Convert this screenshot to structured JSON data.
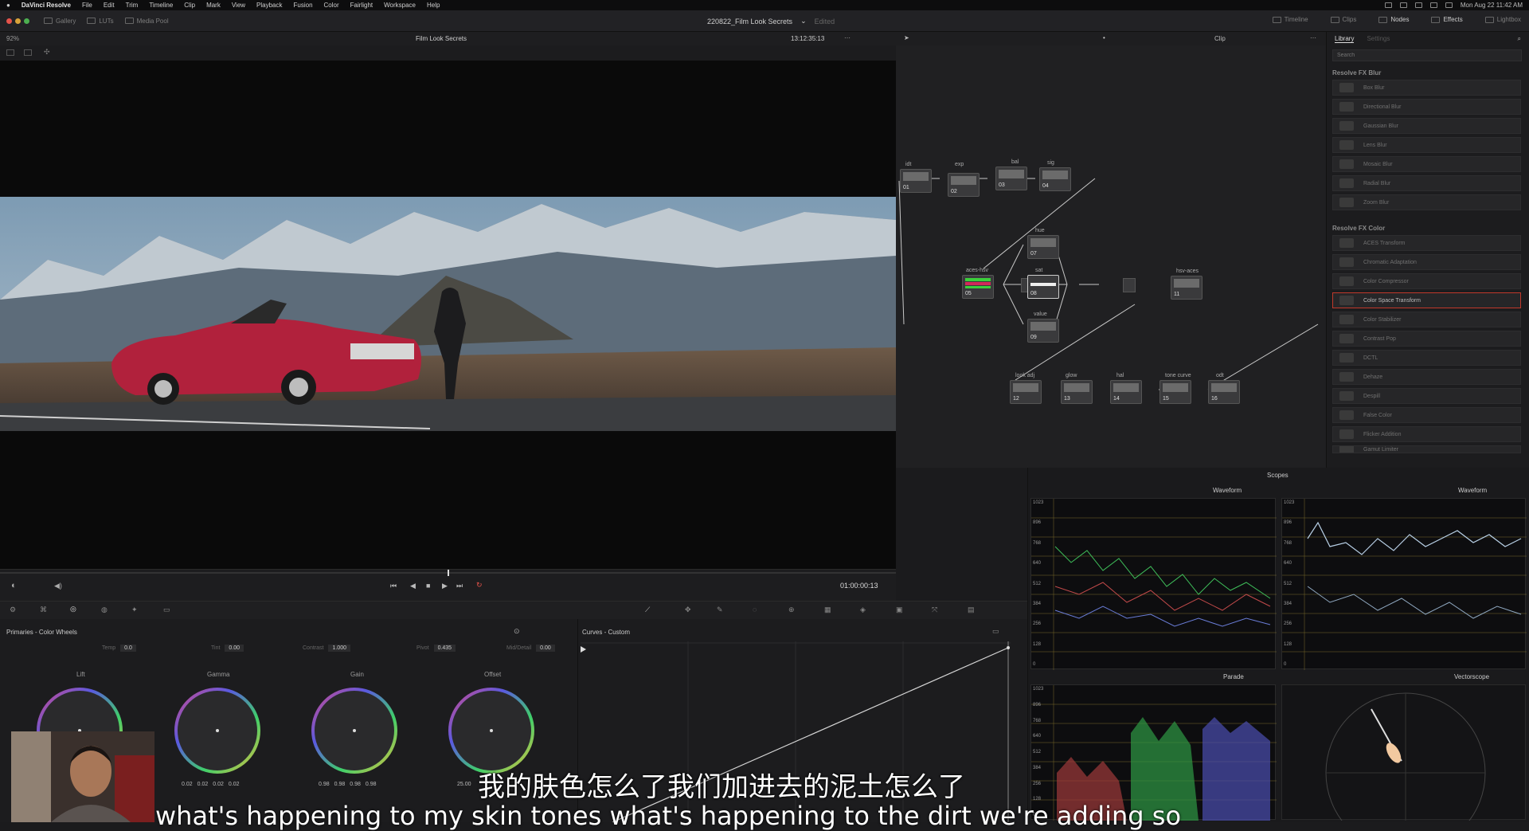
{
  "menubar": {
    "app": "DaVinci Resolve",
    "items": [
      "File",
      "Edit",
      "Trim",
      "Timeline",
      "Clip",
      "Mark",
      "View",
      "Playback",
      "Fusion",
      "Color",
      "Fairlight",
      "Workspace",
      "Help"
    ],
    "clock": "Mon Aug 22  11:42 AM"
  },
  "toolbar": {
    "gallery": "Gallery",
    "luts": "LUTs",
    "media_pool": "Media Pool",
    "project_title": "220822_Film Look Secrets",
    "edited": "Edited",
    "timeline": "Timeline",
    "clips": "Clips",
    "nodes": "Nodes",
    "effects": "Effects",
    "lightbox": "Lightbox"
  },
  "viewer": {
    "zoom": "92%",
    "title": "Film Look Secrets",
    "timecode": "13:12:35:13",
    "mode": "Clip",
    "playhead_tc": "01:00:00:13"
  },
  "library": {
    "tab_library": "Library",
    "tab_settings": "Settings",
    "search_placeholder": "Search",
    "section_blur": "Resolve FX Blur",
    "blur_items": [
      "Box Blur",
      "Directional Blur",
      "Gaussian Blur",
      "Lens Blur",
      "Mosaic Blur",
      "Radial Blur",
      "Zoom Blur"
    ],
    "section_color": "Resolve FX Color",
    "color_items": [
      "ACES Transform",
      "Chromatic Adaptation",
      "Color Compressor",
      "Color Space Transform",
      "Color Stabilizer",
      "Contrast Pop",
      "DCTL",
      "Dehaze",
      "Despill",
      "False Color",
      "Flicker Addition",
      "Gamut Limiter"
    ],
    "selected_item": "Color Space Transform"
  },
  "nodes": {
    "labels": {
      "n01": "idt",
      "n02": "exp",
      "n03": "bal",
      "n04": "sig",
      "n05": "aces-hsv",
      "n07": "hue",
      "n08": "sat",
      "n09": "value",
      "n11": "hsv-aces",
      "n12": "look adj",
      "n13": "glow",
      "n14": "hal",
      "n15": "tone curve",
      "n16": "odt"
    },
    "numbers": {
      "n01": "01",
      "n02": "02",
      "n03": "03",
      "n04": "04",
      "n05": "05",
      "n07": "07",
      "n08": "08",
      "n09": "09",
      "n11": "11",
      "n12": "12",
      "n13": "13",
      "n14": "14",
      "n15": "15",
      "n16": "16"
    }
  },
  "scopes": {
    "title": "Scopes",
    "waveform1": "Waveform",
    "waveform2": "Waveform",
    "parade": "Parade",
    "vectorscope": "Vectorscope",
    "axis": [
      "1023",
      "896",
      "768",
      "640",
      "512",
      "384",
      "256",
      "128",
      "0"
    ]
  },
  "primaries": {
    "title": "Primaries - Color Wheels",
    "temp_label": "Temp",
    "temp_val": "0.0",
    "tint_label": "Tint",
    "tint_val": "0.00",
    "contrast_label": "Contrast",
    "contrast_val": "1.000",
    "pivot_label": "Pivot",
    "pivot_val": "0.435",
    "middetail_label": "Mid/Detail",
    "middetail_val": "0.00",
    "lift": "Lift",
    "gamma": "Gamma",
    "gain": "Gain",
    "offset": "Offset",
    "gamma_vals": [
      "0.02",
      "0.02",
      "0.02",
      "0.02"
    ],
    "gain_vals": [
      "0.98",
      "0.98",
      "0.98",
      "0.98"
    ],
    "offset_val": "25.00"
  },
  "curves": {
    "title": "Curves - Custom"
  },
  "subtitles": {
    "zh": "我的肤色怎么了我们加进去的泥土怎么了",
    "en": "what's happening to my skin tones what's happening to the dirt we're adding so"
  }
}
